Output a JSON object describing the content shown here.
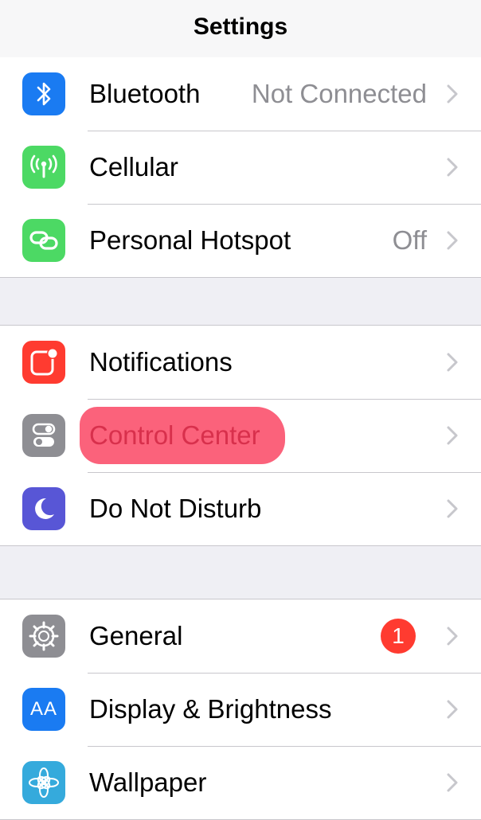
{
  "navbar": {
    "title": "Settings"
  },
  "colors": {
    "bluetooth": "#1a7bf2",
    "cellular": "#4cd964",
    "hotspot": "#4cd964",
    "notifications": "#ff3b30",
    "control_center": "#8e8e93",
    "do_not_disturb": "#5856d6",
    "general": "#8e8e93",
    "display": "#1a7bf2",
    "wallpaper": "#35aadc",
    "annotation": "#fb5a74",
    "badge": "#ff3b30"
  },
  "groups": [
    {
      "rows": [
        {
          "label": "Bluetooth",
          "value": "Not Connected",
          "icon": "bluetooth-icon"
        },
        {
          "label": "Cellular",
          "icon": "cellular-antenna-icon"
        },
        {
          "label": "Personal Hotspot",
          "value": "Off",
          "icon": "hotspot-link-icon"
        }
      ]
    },
    {
      "rows": [
        {
          "label": "Notifications",
          "icon": "notifications-icon"
        },
        {
          "label": "Control Center",
          "icon": "toggle-switches-icon",
          "annotation": "red highlighter mark"
        },
        {
          "label": "Do Not Disturb",
          "icon": "moon-icon"
        }
      ]
    },
    {
      "rows": [
        {
          "label": "General",
          "badge": "1",
          "icon": "gear-icon"
        },
        {
          "label": "Display & Brightness",
          "icon": "text-size-icon",
          "icon_text": "AA"
        },
        {
          "label": "Wallpaper",
          "icon": "flower-icon"
        }
      ]
    }
  ]
}
